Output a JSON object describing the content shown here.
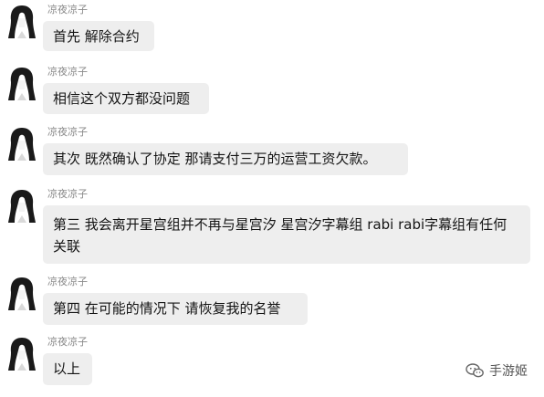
{
  "chat": {
    "messages": [
      {
        "sender": "凉夜凉子",
        "text": "首先 解除合约"
      },
      {
        "sender": "凉夜凉子",
        "text": "相信这个双方都没问题"
      },
      {
        "sender": "凉夜凉子",
        "text": "其次 既然确认了协定 那请支付三万的运营工资欠款。"
      },
      {
        "sender": "凉夜凉子",
        "text": "第三 我会离开星宫组并不再与星宫汐 星宫汐字幕组 rabi rabi字幕组有任何关联"
      },
      {
        "sender": "凉夜凉子",
        "text": "第四 在可能的情况下 请恢复我的名誉"
      },
      {
        "sender": "凉夜凉子",
        "text": "以上"
      }
    ]
  },
  "watermark": {
    "text": "手游姬",
    "icon": "wechat-icon"
  }
}
